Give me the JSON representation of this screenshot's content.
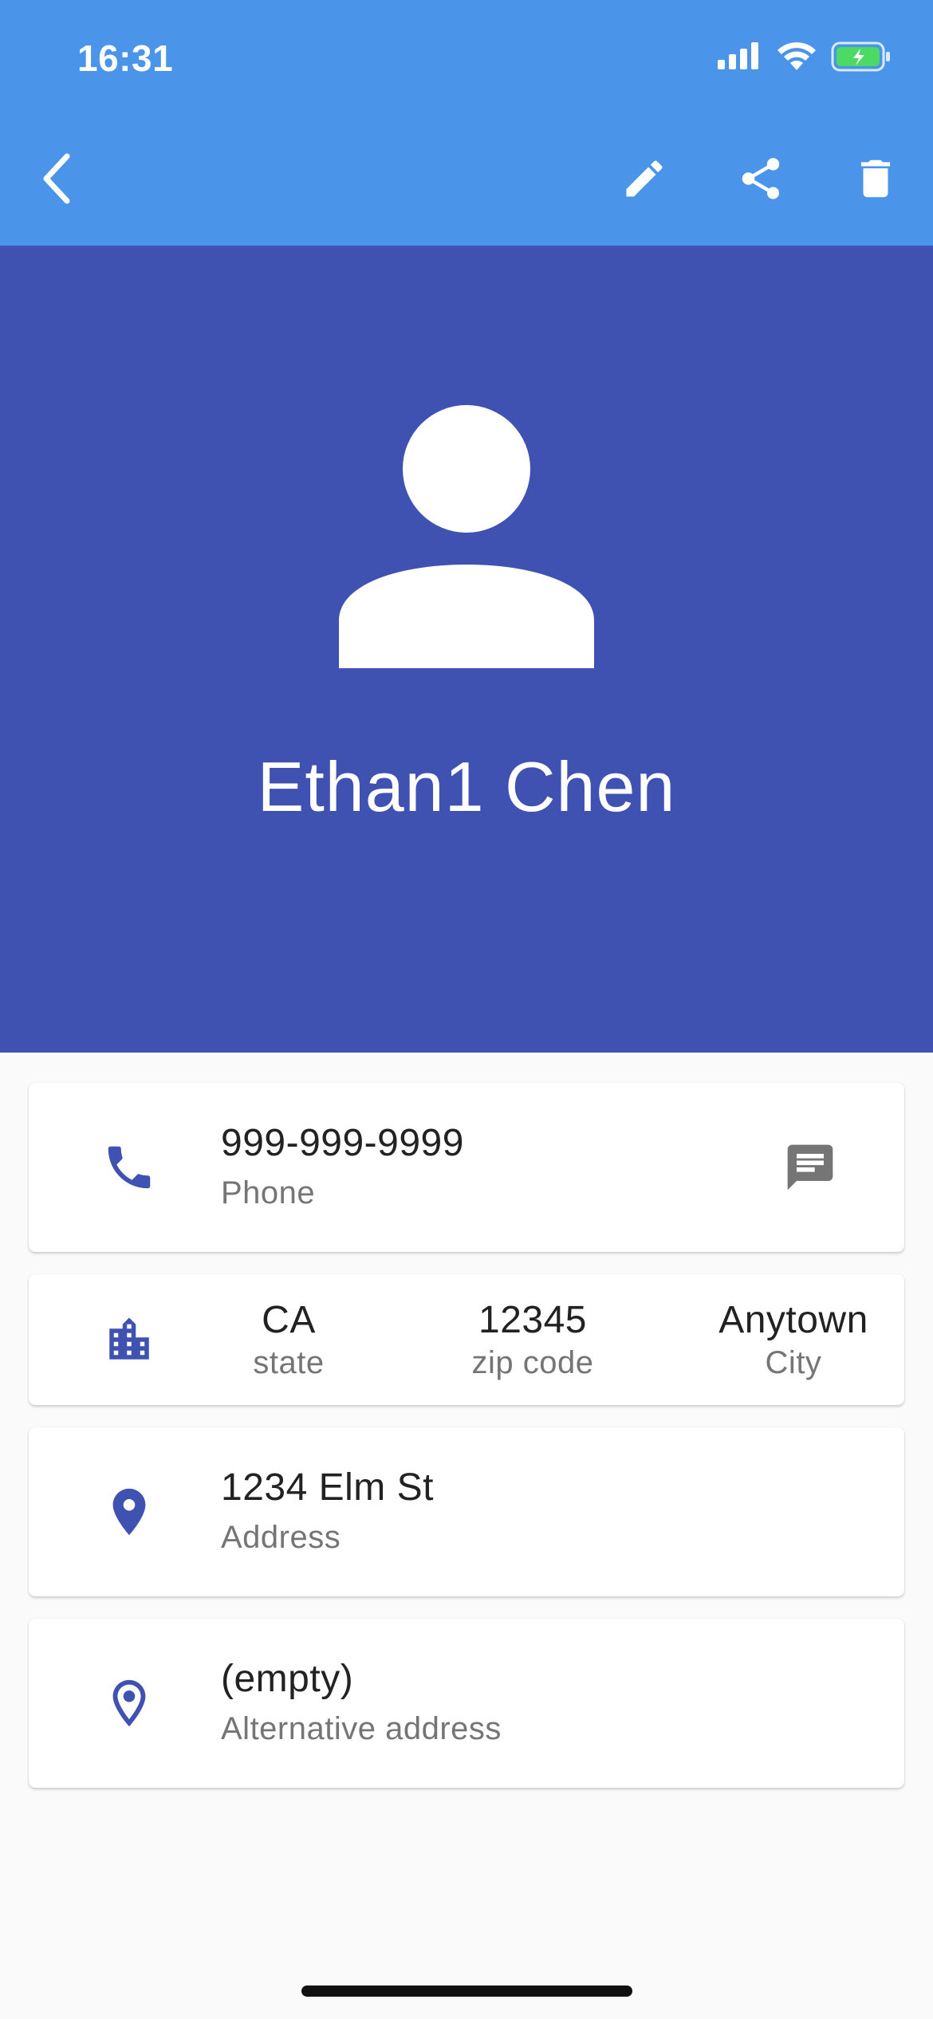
{
  "status_bar": {
    "time": "16:31"
  },
  "app_bar": {
    "back_icon": "chevron-left-icon",
    "actions": [
      "edit-icon",
      "share-icon",
      "delete-icon"
    ],
    "color": "#4a94ea"
  },
  "contact": {
    "name": "Ethan1 Chen",
    "header_color": "#3f51b1"
  },
  "phone_card": {
    "value": "999-999-9999",
    "label": "Phone"
  },
  "location_card": {
    "state": {
      "value": "CA",
      "label": "state"
    },
    "zip": {
      "value": "12345",
      "label": "zip code"
    },
    "city": {
      "value": "Anytown",
      "label": "City"
    }
  },
  "address_card": {
    "value": "1234 Elm St",
    "label": "Address"
  },
  "alt_address_card": {
    "value": "(empty)",
    "label": "Alternative address"
  }
}
